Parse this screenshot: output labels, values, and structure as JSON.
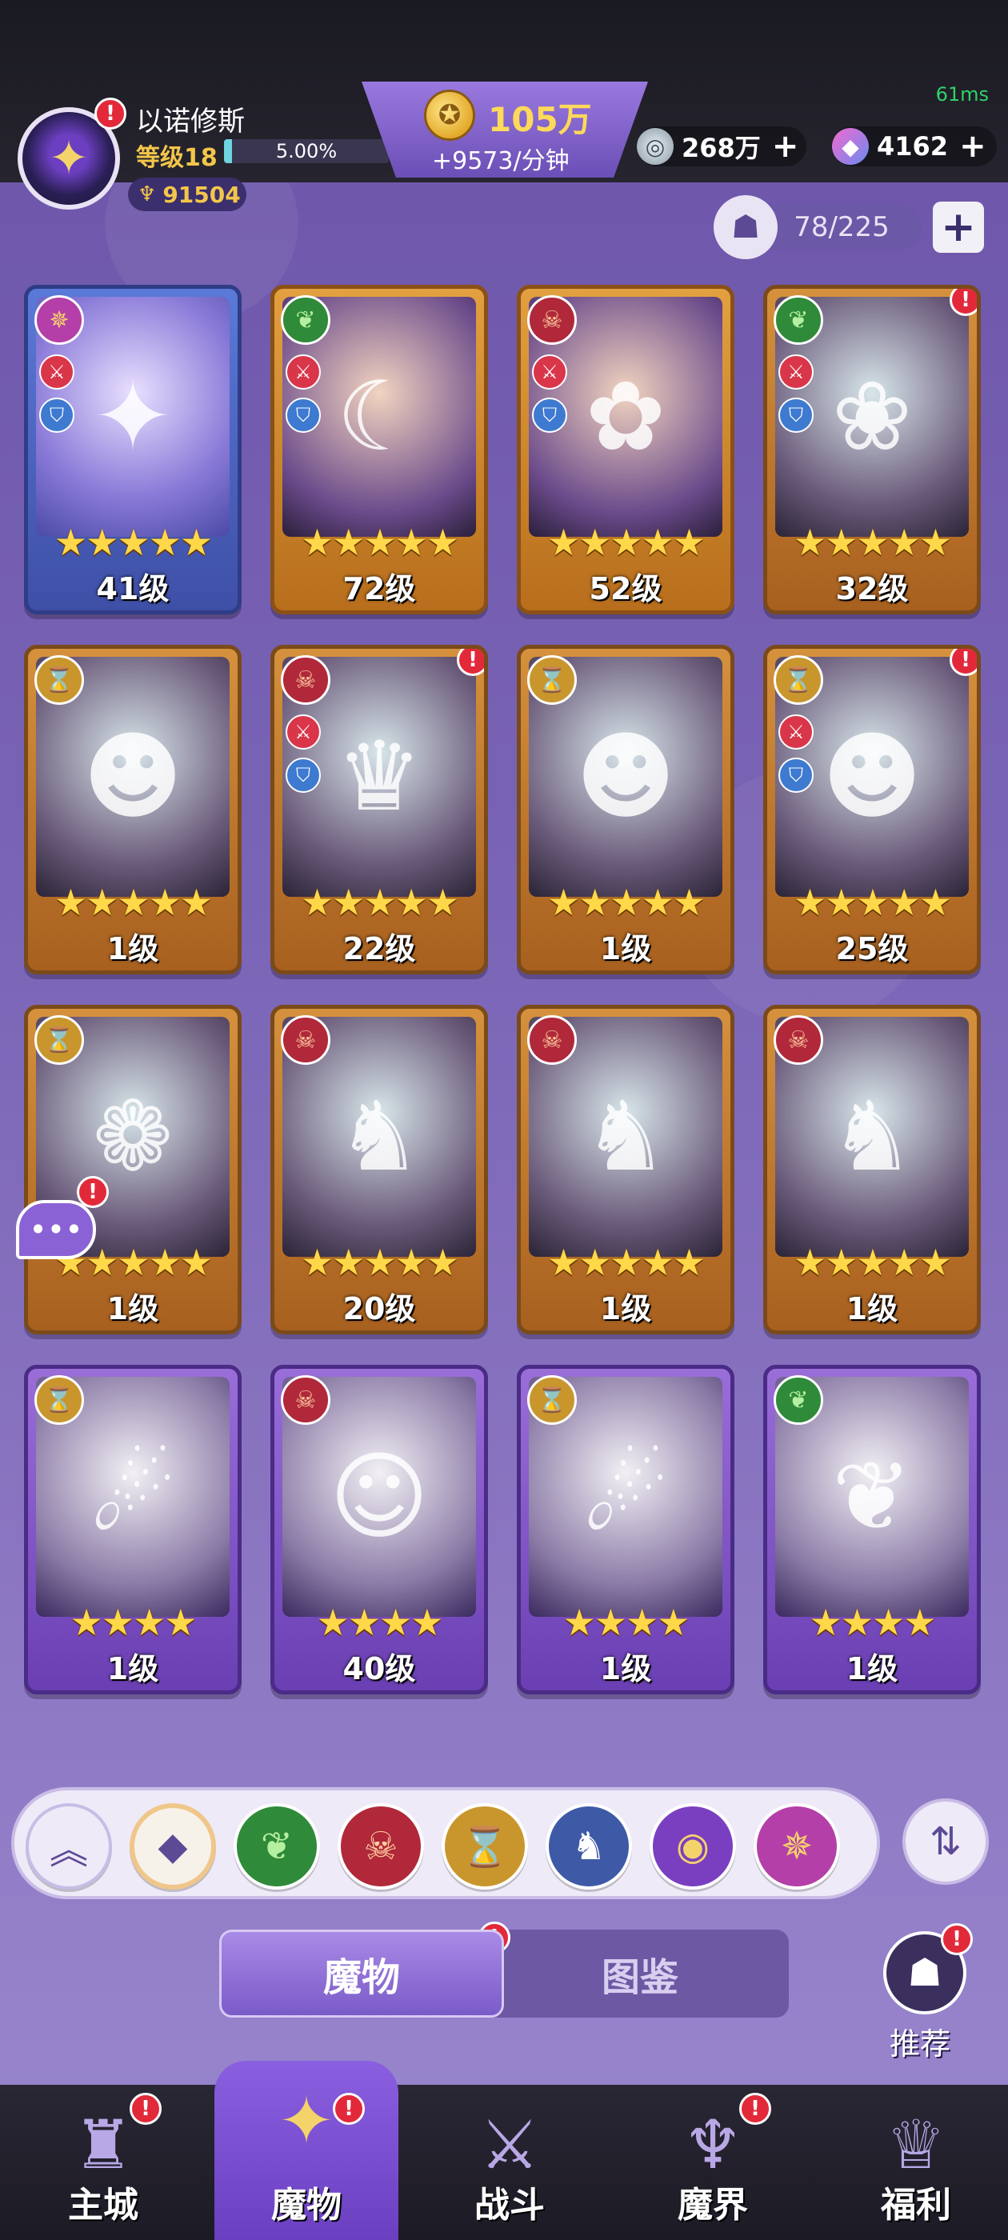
{
  "hud": {
    "ping": "61ms",
    "player_name": "以诺修斯",
    "level_label": "等级18",
    "exp_percent": "5.00%",
    "exp_fraction": 0.05,
    "power": "91504",
    "gold_amount": "105万",
    "gold_rate": "+9573/分钟",
    "silver_amount": "268万",
    "gem_amount": "4162",
    "plus": "+"
  },
  "capacity": {
    "value": "78/225",
    "plus": "+"
  },
  "cards": [
    {
      "faction": "swirl",
      "stars": "★★★★★",
      "level": "41级",
      "style": "blue",
      "badges": true,
      "alert": false,
      "art": "✦"
    },
    {
      "faction": "leaf",
      "stars": "★★★★★",
      "level": "72级",
      "style": "gold",
      "badges": true,
      "alert": false,
      "art": "☾"
    },
    {
      "faction": "mask",
      "stars": "★★★★★",
      "level": "52级",
      "style": "gold",
      "badges": true,
      "alert": false,
      "art": "✿"
    },
    {
      "faction": "leaf",
      "stars": "★★★★★",
      "level": "32级",
      "style": "orange",
      "badges": true,
      "alert": true,
      "art": "❀"
    },
    {
      "faction": "hour",
      "stars": "★★★★★",
      "level": "1级",
      "style": "orange",
      "badges": false,
      "alert": false,
      "art": "☻"
    },
    {
      "faction": "mask",
      "stars": "★★★★★",
      "level": "22级",
      "style": "orange",
      "badges": true,
      "alert": true,
      "art": "♛"
    },
    {
      "faction": "hour",
      "stars": "★★★★★",
      "level": "1级",
      "style": "orange",
      "badges": false,
      "alert": false,
      "art": "☻"
    },
    {
      "faction": "hour",
      "stars": "★★★★★",
      "level": "25级",
      "style": "orange",
      "badges": true,
      "alert": true,
      "art": "☻"
    },
    {
      "faction": "hour",
      "stars": "★★★★★",
      "level": "1级",
      "style": "orange",
      "badges": false,
      "alert": false,
      "art": "❁"
    },
    {
      "faction": "mask",
      "stars": "★★★★★",
      "level": "20级",
      "style": "orange",
      "badges": false,
      "alert": false,
      "art": "♞"
    },
    {
      "faction": "mask",
      "stars": "★★★★★",
      "level": "1级",
      "style": "orange",
      "badges": false,
      "alert": false,
      "art": "♞"
    },
    {
      "faction": "mask",
      "stars": "★★★★★",
      "level": "1级",
      "style": "orange",
      "badges": false,
      "alert": false,
      "art": "♞"
    },
    {
      "faction": "hour",
      "stars": "★★★★",
      "level": "1级",
      "style": "purple",
      "badges": false,
      "alert": false,
      "art": "☄"
    },
    {
      "faction": "mask",
      "stars": "★★★★",
      "level": "40级",
      "style": "purple",
      "badges": false,
      "alert": false,
      "art": "☺"
    },
    {
      "faction": "hour",
      "stars": "★★★★",
      "level": "1级",
      "style": "purple",
      "badges": false,
      "alert": false,
      "art": "☄"
    },
    {
      "faction": "leaf",
      "stars": "★★★★",
      "level": "1级",
      "style": "purple",
      "badges": false,
      "alert": false,
      "art": "❦"
    }
  ],
  "filters": [
    {
      "name": "collapse-up-icon",
      "glyph": "︽",
      "color": "#efeaf8",
      "fg": "#5d4a95"
    },
    {
      "name": "all-factions-icon",
      "glyph": "◆",
      "color": "#f6f2ea",
      "fg": "#5d4a95"
    },
    {
      "name": "nature-faction-icon",
      "glyph": "❦",
      "color": "#2f8a3a",
      "fg": "#b5f0a0"
    },
    {
      "name": "demon-faction-icon",
      "glyph": "☠",
      "color": "#b0283a",
      "fg": "#ffd0a0"
    },
    {
      "name": "time-faction-icon",
      "glyph": "⌛",
      "color": "#c9962e",
      "fg": "#3a2a10"
    },
    {
      "name": "dragon-faction-icon",
      "glyph": "♞",
      "color": "#3e5aa6",
      "fg": "#ffffff"
    },
    {
      "name": "eye-faction-icon",
      "glyph": "◉",
      "color": "#7a3fc0",
      "fg": "#f4d36b"
    },
    {
      "name": "swirl-faction-icon",
      "glyph": "✵",
      "color": "#b43fa8",
      "fg": "#f4d36b"
    }
  ],
  "tabs": {
    "monsters": "魔物",
    "codex": "图鉴"
  },
  "recommend": {
    "label": "推荐"
  },
  "nav": [
    {
      "label": "主城",
      "icon": "castle-icon",
      "glyph": "♜",
      "alert": true,
      "active": false
    },
    {
      "label": "魔物",
      "icon": "monster-flame-icon",
      "glyph": "✦",
      "alert": true,
      "active": true
    },
    {
      "label": "战斗",
      "icon": "battle-shield-icon",
      "glyph": "⚔",
      "alert": false,
      "active": false
    },
    {
      "label": "魔界",
      "icon": "demon-realm-icon",
      "glyph": "♆",
      "alert": true,
      "active": false
    },
    {
      "label": "福利",
      "icon": "welfare-chest-icon",
      "glyph": "♕",
      "alert": false,
      "active": false
    }
  ],
  "alert_mark": "!",
  "colors": {
    "gold": "#ffd95a",
    "star": "#ffd84a",
    "alert": "#e2293a",
    "accent": "#7b5bc8"
  }
}
